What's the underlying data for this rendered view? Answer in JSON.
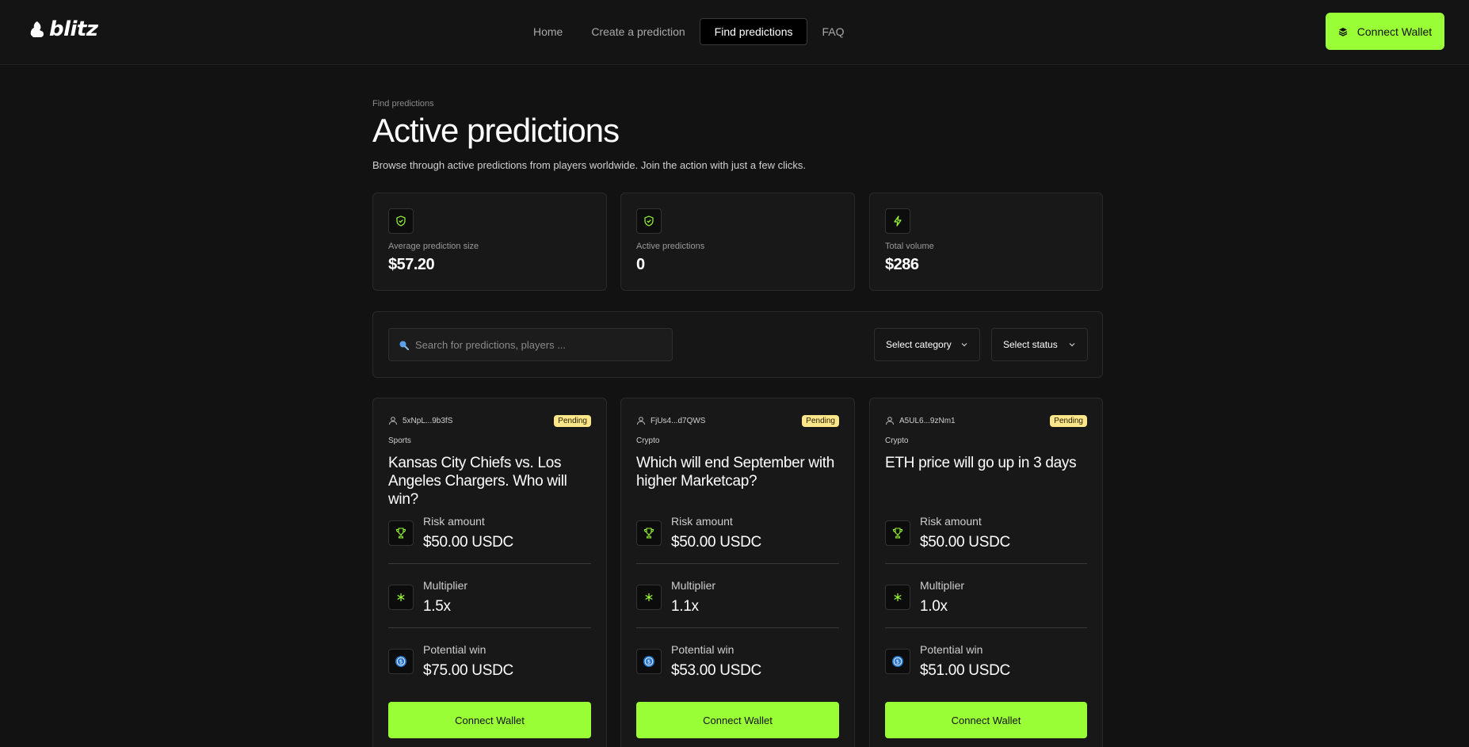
{
  "header": {
    "logo_text": "blitz",
    "nav": [
      {
        "label": "Home"
      },
      {
        "label": "Create a prediction"
      },
      {
        "label": "Find predictions",
        "active": true
      },
      {
        "label": "FAQ"
      }
    ],
    "connect_label": "Connect Wallet"
  },
  "page": {
    "breadcrumb": "Find predictions",
    "title": "Active predictions",
    "subtitle": "Browse through active predictions from players worldwide. Join the action with just a few clicks."
  },
  "stats": [
    {
      "label": "Average prediction size",
      "value": "$57.20",
      "icon": "shield-check-icon"
    },
    {
      "label": "Active predictions",
      "value": "0",
      "icon": "shield-check-icon"
    },
    {
      "label": "Total volume",
      "value": "$286",
      "icon": "lightning-icon"
    }
  ],
  "filters": {
    "search_placeholder": "Search for predictions, players ...",
    "category_label": "Select category",
    "status_label": "Select status"
  },
  "cards": [
    {
      "player": "5xNpL...9b3fS",
      "status": "Pending",
      "category": "Sports",
      "title": "Kansas City Chiefs vs. Los Angeles Chargers. Who will win?",
      "risk_label": "Risk amount",
      "risk_value": "$50.00 USDC",
      "multiplier_label": "Multiplier",
      "multiplier_value": "1.5x",
      "win_label": "Potential win",
      "win_value": "$75.00 USDC",
      "button": "Connect Wallet"
    },
    {
      "player": "FjUs4...d7QWS",
      "status": "Pending",
      "category": "Crypto",
      "title": "Which will end September with higher Marketcap?",
      "risk_label": "Risk amount",
      "risk_value": "$50.00 USDC",
      "multiplier_label": "Multiplier",
      "multiplier_value": "1.1x",
      "win_label": "Potential win",
      "win_value": "$53.00 USDC",
      "button": "Connect Wallet"
    },
    {
      "player": "A5UL6...9zNm1",
      "status": "Pending",
      "category": "Crypto",
      "title": "ETH price will go up in 3 days",
      "risk_label": "Risk amount",
      "risk_value": "$50.00 USDC",
      "multiplier_label": "Multiplier",
      "multiplier_value": "1.0x",
      "win_label": "Potential win",
      "win_value": "$51.00 USDC",
      "button": "Connect Wallet"
    }
  ],
  "colors": {
    "accent": "#9afe36",
    "background": "#121212",
    "badge_pending": "#fce68a",
    "usdc_blue": "#2775ca"
  }
}
